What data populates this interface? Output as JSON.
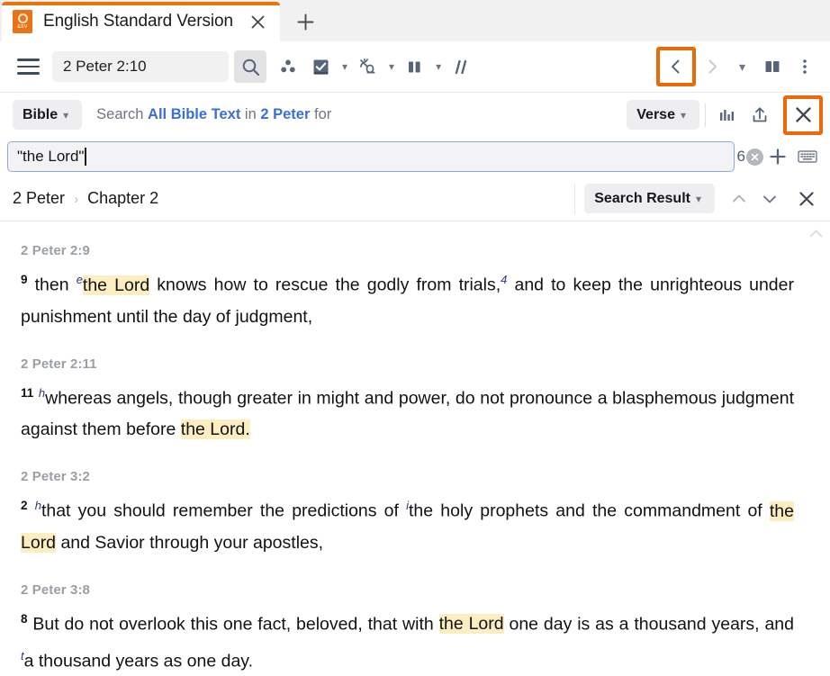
{
  "browser": {
    "tab": {
      "title": "English Standard Version",
      "favicon_label": "ESV",
      "close_icon": "close-icon"
    },
    "new_tab_label": "+"
  },
  "toolbar": {
    "menu_icon": "hamburger-icon",
    "reference": "2 Peter 2:10",
    "search_icon": "search-icon",
    "resources_icon": "resource-guide-icon",
    "books_icon": "books-icon",
    "original_language_icon": "hebrew-greek-icon",
    "parallel_icon": "parallel-columns-icon",
    "visual_filters_icon": "visual-filters-icon",
    "back_icon": "chevron-left-icon",
    "forward_icon": "chevron-right-icon",
    "history_caret_icon": "chevron-down-icon",
    "layout_icon": "split-layout-icon",
    "overflow_icon": "kebab-menu-icon"
  },
  "scope": {
    "type_label": "Bible",
    "sentence_prefix": "Search",
    "range_all": "All Bible Text",
    "sentence_in": "in",
    "range_book": "2 Peter",
    "sentence_suffix": "for",
    "result_mode_label": "Verse",
    "analysis_icon": "chart-bars-icon",
    "share_icon": "share-upload-icon",
    "close_icon": "close-icon"
  },
  "search": {
    "query": "\"the Lord\"",
    "match_count": "6",
    "clear_icon": "clear-circle-icon",
    "add_icon": "plus-icon",
    "keyboard_icon": "keyboard-icon"
  },
  "breadcrumb": {
    "book": "2 Peter",
    "separator": "›",
    "chapter": "Chapter 2",
    "result_label": "Search Result",
    "prev_icon": "chevron-up-icon",
    "next_icon": "chevron-down-icon",
    "close_icon": "close-icon"
  },
  "content": {
    "scroll_hint_icon": "chevron-up-icon",
    "verses": [
      {
        "ref": "2 Peter 2:9",
        "num": "9",
        "parts": [
          {
            "t": " then ",
            "style": "plain"
          },
          {
            "t": "e",
            "style": "footnote"
          },
          {
            "t": "the Lord",
            "style": "highlight"
          },
          {
            "t": " knows how to rescue the godly from trials,",
            "style": "plain"
          },
          {
            "t": "4",
            "style": "footnote"
          },
          {
            "t": " and to keep the unrighteous under punishment until the day of judgment,",
            "style": "plain"
          }
        ]
      },
      {
        "ref": "2 Peter 2:11",
        "num": "11",
        "parts": [
          {
            "t": " ",
            "style": "plain"
          },
          {
            "t": "h",
            "style": "footnote"
          },
          {
            "t": "whereas angels, though greater in might and power, do not pronounce a blasphemous judgment against them before ",
            "style": "plain"
          },
          {
            "t": "the Lord.",
            "style": "highlight"
          }
        ]
      },
      {
        "ref": "2 Peter 3:2",
        "num": "2",
        "parts": [
          {
            "t": " ",
            "style": "plain"
          },
          {
            "t": "h",
            "style": "footnote"
          },
          {
            "t": "that you should remember the predictions of ",
            "style": "plain"
          },
          {
            "t": "i",
            "style": "footnote"
          },
          {
            "t": "the holy prophets and the commandment of ",
            "style": "plain"
          },
          {
            "t": "the Lord",
            "style": "highlight"
          },
          {
            "t": " and Savior through your apostles,",
            "style": "plain"
          }
        ]
      },
      {
        "ref": "2 Peter 3:8",
        "num": "8",
        "parts": [
          {
            "t": " But do not overlook this one fact, beloved, that with ",
            "style": "plain"
          },
          {
            "t": "the Lord",
            "style": "highlight"
          },
          {
            "t": " one day is as a thousand years, and ",
            "style": "plain"
          },
          {
            "t": "t",
            "style": "footnote"
          },
          {
            "t": "a thousand years as one day.",
            "style": "plain"
          }
        ]
      }
    ]
  },
  "colors": {
    "accent_orange": "#ea6a0a",
    "tab_bar_orange": "#e8740c",
    "link_blue": "#3a6fd8",
    "highlight_yellow": "#fdeec2",
    "icon_slate": "#57657a"
  }
}
